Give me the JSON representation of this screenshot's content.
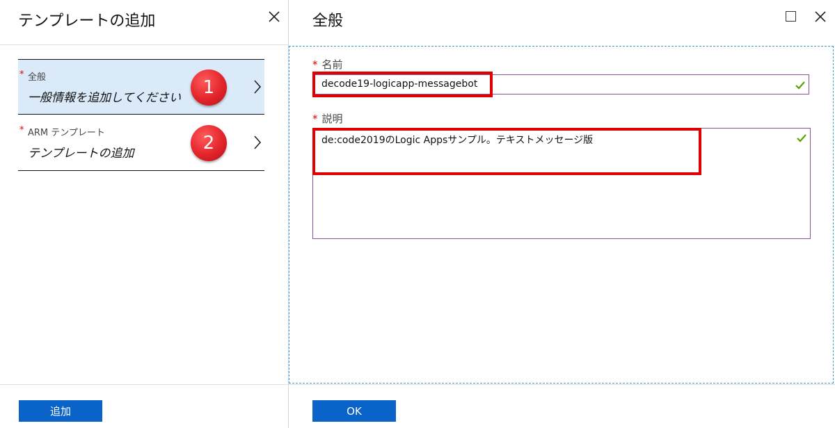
{
  "left_blade": {
    "title": "テンプレートの追加",
    "close_icon": "close-icon",
    "steps": [
      {
        "required_mark": "*",
        "label": "全般",
        "description": "一般情報を追加してください",
        "badge": "1",
        "active": true
      },
      {
        "required_mark": "*",
        "label": "ARM テンプレート",
        "description": "テンプレートの追加",
        "badge": "2",
        "active": false
      }
    ],
    "add_button_label": "追加"
  },
  "right_blade": {
    "title": "全般",
    "maximize_icon": "maximize-icon",
    "close_icon": "close-icon",
    "name_field": {
      "required_mark": "*",
      "label": "名前",
      "value": "decode19-logicapp-messagebot",
      "valid": true
    },
    "description_field": {
      "required_mark": "*",
      "label": "説明",
      "value": "de:code2019のLogic Appsサンプル。テキストメッセージ版",
      "valid": true
    },
    "ok_button_label": "OK"
  },
  "colors": {
    "accent_blue": "#0a63c8",
    "selected_step_bg": "#daeaf8",
    "required_red": "#e00000",
    "badge_red": "#e3242b",
    "input_border": "#8a4f9e",
    "valid_check": "#57a300",
    "highlight_box": "#e00000",
    "focus_dashed": "#3a9bd8"
  }
}
